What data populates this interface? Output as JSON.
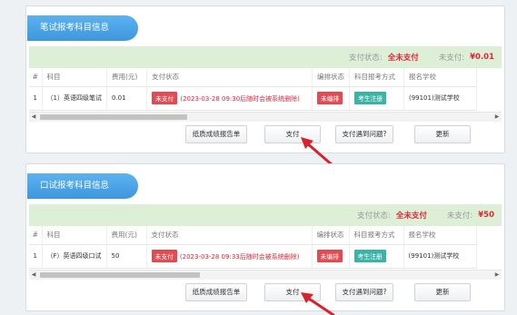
{
  "columns": [
    "#",
    "科目",
    "费用(元)",
    "支付状态",
    "编排状态",
    "科目报考方式",
    "报名学校"
  ],
  "sections": [
    {
      "title": "笔试报考科目信息",
      "status_label": "支付状态:",
      "status_value": "全未支付",
      "unpaid_label": "未支付:",
      "unpaid_value": "¥0.01",
      "rows": [
        {
          "index": "1",
          "subject": "（1）英语四级笔试",
          "fee": "0.01",
          "pay_badge": "未支付",
          "pay_note": "(2023-03-28 09:30后随时会被系统删除)",
          "arrange_badge": "未编排",
          "method_badge": "考生注册",
          "school": "(99101)测试学校"
        }
      ],
      "buttons": {
        "paper_report": "纸质成绩报告单",
        "pay": "支付",
        "pay_problem": "支付遇到问题?",
        "refresh": "更新"
      }
    },
    {
      "title": "口试报考科目信息",
      "status_label": "支付状态:",
      "status_value": "全未支付",
      "unpaid_label": "未支付:",
      "unpaid_value": "¥50",
      "rows": [
        {
          "index": "1",
          "subject": "（F）英语四级口试",
          "fee": "50",
          "pay_badge": "未支付",
          "pay_note": "(2023-03-28 09:33后随时会被系统删除)",
          "arrange_badge": "未编排",
          "method_badge": "考生注册",
          "school": "(99101)测试学校"
        }
      ],
      "buttons": {
        "paper_report": "纸质成绩报告单",
        "pay": "支付",
        "pay_problem": "支付遇到问题?",
        "refresh": "更新"
      }
    }
  ],
  "scroll_left_icon": "chevron-left-icon",
  "scroll_right_icon": "chevron-right-icon",
  "pointer_icon": "red-arrow-icon",
  "colors": {
    "tab_blue": "#3e97dd",
    "status_bg": "#ddf0d7",
    "alert_red": "#e0263a",
    "badge_red": "#e44a52",
    "badge_teal": "#3cb3a7"
  }
}
